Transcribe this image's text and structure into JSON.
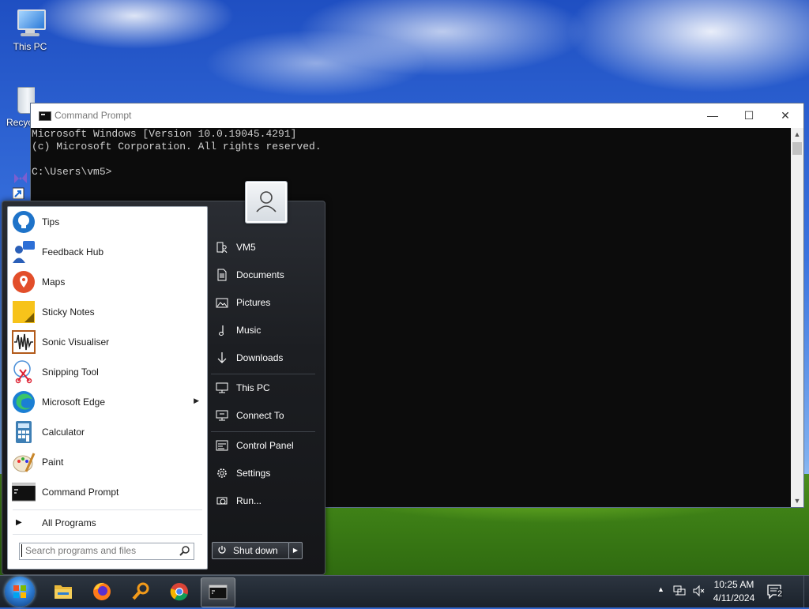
{
  "desktop": {
    "icons": [
      {
        "label": "This PC"
      },
      {
        "label": "Recyc"
      }
    ]
  },
  "cmd_window": {
    "title": "Command Prompt",
    "controls": {
      "minimize": "—",
      "maximize": "☐",
      "close": "✕"
    },
    "lines": [
      "Microsoft Windows [Version 10.0.19045.4291]",
      "(c) Microsoft Corporation. All rights reserved.",
      "",
      "C:\\Users\\vm5>"
    ]
  },
  "start_menu": {
    "programs": [
      {
        "label": "Tips",
        "icon": "tips-icon"
      },
      {
        "label": "Feedback Hub",
        "icon": "feedback-hub-icon"
      },
      {
        "label": "Maps",
        "icon": "maps-icon"
      },
      {
        "label": "Sticky Notes",
        "icon": "sticky-notes-icon"
      },
      {
        "label": "Sonic Visualiser",
        "icon": "sonic-visualiser-icon"
      },
      {
        "label": "Snipping Tool",
        "icon": "snipping-tool-icon"
      },
      {
        "label": "Microsoft Edge",
        "icon": "edge-icon",
        "submenu": true
      },
      {
        "label": "Calculator",
        "icon": "calculator-icon"
      },
      {
        "label": "Paint",
        "icon": "paint-icon"
      },
      {
        "label": "Command Prompt",
        "icon": "command-prompt-icon"
      }
    ],
    "all_programs": "All Programs",
    "search_placeholder": "Search programs and files",
    "right_items": [
      {
        "label": "VM5",
        "icon": "user-folder-icon"
      },
      {
        "label": "Documents",
        "icon": "documents-icon"
      },
      {
        "label": "Pictures",
        "icon": "pictures-icon"
      },
      {
        "label": "Music",
        "icon": "music-icon"
      },
      {
        "label": "Downloads",
        "icon": "downloads-icon"
      },
      {
        "label": "This PC",
        "icon": "computer-icon"
      },
      {
        "label": "Connect To",
        "icon": "connect-to-icon"
      },
      {
        "label": "Control Panel",
        "icon": "control-panel-icon"
      },
      {
        "label": "Settings",
        "icon": "gear-icon"
      },
      {
        "label": "Run...",
        "icon": "run-icon"
      }
    ],
    "shutdown_label": "Shut down"
  },
  "taskbar": {
    "pinned": [
      "file-explorer-icon",
      "firefox-icon",
      "search-tool-icon",
      "chrome-icon",
      "command-prompt-icon"
    ],
    "clock": {
      "time": "10:25 AM",
      "date": "4/11/2024"
    },
    "notifications_count": "2"
  },
  "colors": {
    "cmd_bg": "#0c0c0c",
    "cmd_text": "#cfcfcf",
    "startmenu_bg": "#1c1e22",
    "taskbar_bg": "#1b222b"
  }
}
